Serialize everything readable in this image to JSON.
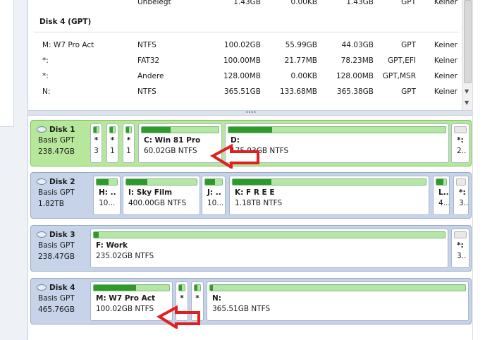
{
  "table": {
    "top_row": {
      "status": "Unbelegt",
      "capacity": "1.43GB",
      "used": "0.00KB",
      "free": "1.43GB",
      "type": "GPT",
      "extra": "Keiner"
    },
    "disk_header": "Disk 4 (GPT)",
    "rows": [
      {
        "name": "M: W7 Pro Act",
        "fs": "NTFS",
        "capacity": "100.02GB",
        "used": "55.99GB",
        "free": "44.03GB",
        "type": "GPT",
        "status": "Keiner"
      },
      {
        "name": "*:",
        "fs": "FAT32",
        "capacity": "100.00MB",
        "used": "21.77MB",
        "free": "78.23MB",
        "type": "GPT,EFI",
        "status": "Keiner"
      },
      {
        "name": "*:",
        "fs": "Andere",
        "capacity": "128.00MB",
        "used": "0.00KB",
        "free": "128.00MB",
        "type": "GPT,MSR",
        "status": "Keiner"
      },
      {
        "name": "N:",
        "fs": "NTFS",
        "capacity": "365.51GB",
        "used": "133.68MB",
        "free": "365.38GB",
        "type": "GPT",
        "status": "Keiner"
      }
    ]
  },
  "disks": [
    {
      "name": "Disk 1",
      "type": "Basis GPT",
      "size": "238.47GB",
      "selected": true,
      "partitions": [
        {
          "label": "*",
          "info": "3",
          "used_fraction": 0.5,
          "tiny": true
        },
        {
          "label": "*",
          "info": "1",
          "used_fraction": 0.5,
          "tiny": true
        },
        {
          "label": "*",
          "info": "1",
          "used_fraction": 0.5,
          "tiny": true
        },
        {
          "label": "C: Win 81 Pro",
          "info": "60.02GB NTFS",
          "used_fraction": 0.38
        },
        {
          "label": "D:",
          "info": "175.93GB NTFS",
          "used_fraction": 0.2
        },
        {
          "label": "*:",
          "info": "2..",
          "used_fraction": 0.0,
          "unallocated": true
        }
      ]
    },
    {
      "name": "Disk 2",
      "type": "Basis GPT",
      "size": "1.82TB",
      "selected": false,
      "partitions": [
        {
          "label": "H: ..",
          "info": "10...",
          "used_fraction": 0.6
        },
        {
          "label": "I: Sky Film",
          "info": "400.00GB NTFS",
          "used_fraction": 0.3
        },
        {
          "label": "J: ..",
          "info": "10...",
          "used_fraction": 0.6
        },
        {
          "label": "K: F R E E",
          "info": "1.18TB NTFS",
          "used_fraction": 0.2
        },
        {
          "label": "L..",
          "info": "4...",
          "used_fraction": 0.7
        },
        {
          "label": "*:",
          "info": "3..",
          "used_fraction": 0.0,
          "unallocated": true
        }
      ]
    },
    {
      "name": "Disk 3",
      "type": "Basis GPT",
      "size": "238.47GB",
      "selected": false,
      "partitions": [
        {
          "label": "F: Work",
          "info": "235.02GB NTFS",
          "used_fraction": 0.015
        },
        {
          "label": "*:",
          "info": "3..",
          "used_fraction": 0.0,
          "unallocated": true
        }
      ]
    },
    {
      "name": "Disk 4",
      "type": "Basis GPT",
      "size": "465.76GB",
      "selected": false,
      "partitions": [
        {
          "label": "M: W7 Pro Act",
          "info": "100.02GB NTFS",
          "used_fraction": 0.56
        },
        {
          "label": "*",
          "info": "",
          "used_fraction": 0.5,
          "tiny": true
        },
        {
          "label": "*",
          "info": "",
          "used_fraction": 0.5,
          "tiny": true
        },
        {
          "label": "N:",
          "info": "365.51GB NTFS",
          "used_fraction": 0.01
        }
      ]
    }
  ],
  "colors": {
    "selected_disk": "#b7e79a",
    "disk_bg": "#c6d3e8",
    "used_fill": "#2e9a2e",
    "free_fill": "#b4e7a5",
    "annotation_arrow": "#e02020"
  },
  "icons": {
    "disk": "hard-disk-icon",
    "annotation": "red-arrow-icon"
  }
}
